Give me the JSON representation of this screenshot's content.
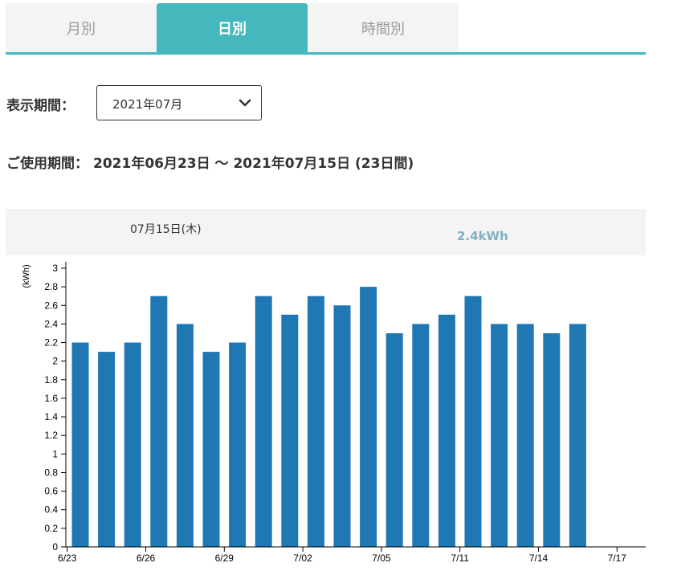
{
  "tabs": [
    {
      "label": "月別",
      "active": false
    },
    {
      "label": "日別",
      "active": true
    },
    {
      "label": "時間別",
      "active": false
    }
  ],
  "period": {
    "label": "表示期間：",
    "selected": "2021年07月"
  },
  "usage_period": {
    "label": "ご使用期間：",
    "value": "2021年06月23日 〜 2021年07月15日 (23日間)"
  },
  "selected_info": {
    "date": "07月15日(木)",
    "value": "2.4kWh"
  },
  "colors": {
    "accent": "#44b8bd",
    "bar": "#1f77b4",
    "value_text": "#7fb0c3"
  },
  "icons": {
    "select": "chevron-down-icon"
  },
  "chart_data": {
    "type": "bar",
    "ylabel": "(kWh)",
    "ylim": [
      0,
      3
    ],
    "yticks": [
      "0",
      "0.2",
      "0.4",
      "0.6",
      "0.8",
      "1",
      "1.2",
      "1.4",
      "1.6",
      "1.8",
      "2",
      "2.2",
      "2.4",
      "2.6",
      "2.8",
      "3"
    ],
    "x_tick_labels": [
      "6/23",
      "6/26",
      "6/29",
      "7/02",
      "7/05",
      "7/11",
      "7/14",
      "7/17"
    ],
    "categories": [
      "6/23",
      "6/24",
      "6/25",
      "6/26",
      "6/27",
      "6/28",
      "6/29",
      "6/30",
      "7/01",
      "7/02",
      "7/03",
      "7/04",
      "7/05",
      "7/06",
      "7/07",
      "7/08",
      "7/09",
      "7/10",
      "7/11",
      "7/12",
      "7/13",
      "7/14",
      "7/15"
    ],
    "values": [
      2.2,
      2.1,
      2.2,
      2.7,
      2.4,
      2.1,
      2.2,
      2.7,
      2.5,
      2.7,
      2.6,
      2.8,
      2.3,
      2.4,
      2.5,
      2.7,
      2.4,
      2.4,
      2.3,
      2.4
    ],
    "grid": false,
    "legend": "none"
  }
}
